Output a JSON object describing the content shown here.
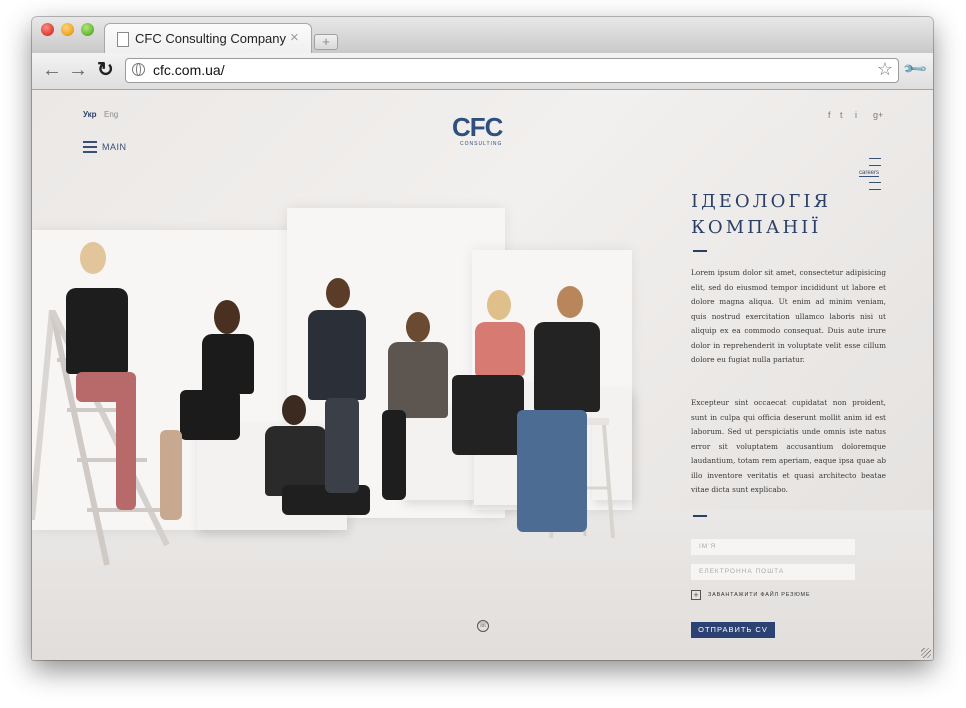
{
  "browser": {
    "tab_title": "CFC Consulting Company",
    "url": "cfc.com.ua/",
    "icons": {
      "back": "back-arrow-icon",
      "forward": "forward-arrow-icon",
      "reload": "reload-icon",
      "bookmark": "star-icon",
      "menu": "wrench-icon"
    }
  },
  "site": {
    "lang_active": "Укр",
    "lang_other": "Eng",
    "menu_label": "MAIN",
    "logo": "CFC",
    "logo_sub": "CONSULTING",
    "social": [
      "f",
      "t",
      "i",
      "g+"
    ],
    "careers_label": "careers",
    "heading_line1": "ІДЕОЛОГІЯ",
    "heading_line2": "КОМПАНІЇ",
    "paragraph1": "Lorem ipsum dolor sit amet, consectetur adipisicing elit, sed do eiusmod tempor incididunt ut labore et dolore magna aliqua. Ut enim ad minim veniam, quis nostrud exercitation ullamco laboris nisi ut aliquip ex ea commodo consequat. Duis aute irure dolor in reprehenderit in voluptate velit esse cillum dolore eu fugiat nulla pariatur.",
    "paragraph2": "Excepteur sint occaecat cupidatat non proident, sunt in culpa qui officia deserunt mollit anim id est laborum. Sed ut perspiciatis unde omnis iste natus error sit voluptatem accusantium doloremque laudantium, totam rem aperiam, eaque ipsa quae ab illo inventore veritatis et quasi architecto beatae vitae dicta sunt explicabo.",
    "form": {
      "name_placeholder": "ІМ'Я",
      "email_placeholder": "ЕЛЕКТРОННА ПОШТА",
      "upload_label": "ЗАВАНТАЖИТИ ФАЙЛ РЕЗЮМЕ",
      "submit_label": "ОТПРАВИТЬ CV"
    },
    "colors": {
      "brand": "#2c4272",
      "text": "#3a3a3a"
    }
  }
}
